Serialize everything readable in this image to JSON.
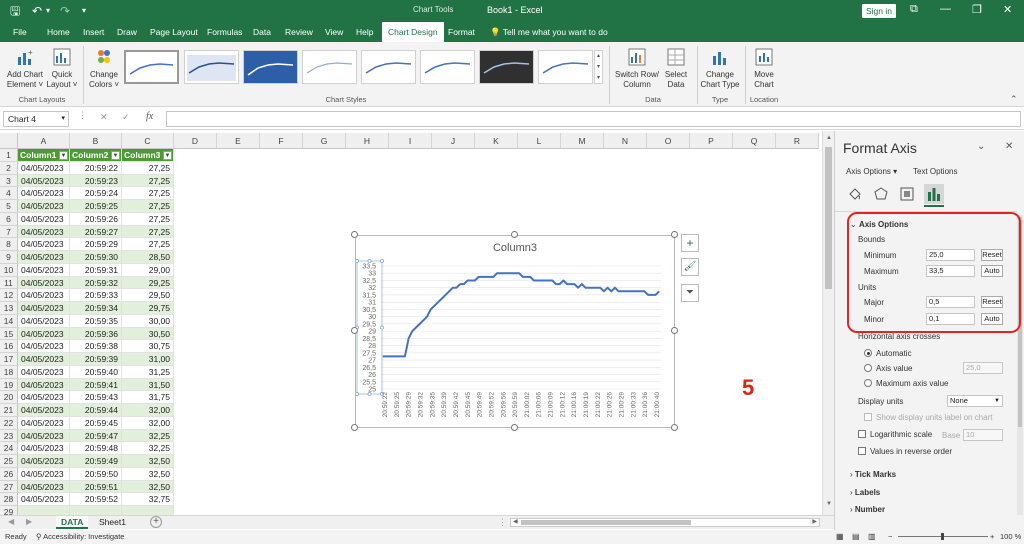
{
  "titlebar": {
    "document": "Book1  -  Excel",
    "context_label": "Chart Tools",
    "sign_in": "Sign in"
  },
  "tabs": [
    "File",
    "Home",
    "Insert",
    "Draw",
    "Page Layout",
    "Formulas",
    "Data",
    "Review",
    "View",
    "Help",
    "Chart Design",
    "Format"
  ],
  "active_tab": "Chart Design",
  "tell_me": "Tell me what you want to do",
  "ribbon": {
    "add_chart_element": "Add Chart\nElement ˅",
    "quick_layout": "Quick\nLayout ˅",
    "change_colors": "Change\nColors ˅",
    "group_chart_layouts": "Chart Layouts",
    "group_chart_styles": "Chart Styles",
    "switch_row_column": "Switch Row/\nColumn",
    "select_data": "Select\nData",
    "group_data": "Data",
    "change_chart_type": "Change\nChart Type",
    "group_type": "Type",
    "move_chart": "Move\nChart",
    "group_location": "Location"
  },
  "formula_bar": {
    "name_box": "Chart 4",
    "fx": "fx"
  },
  "columns": [
    "A",
    "B",
    "C",
    "D",
    "E",
    "F",
    "G",
    "H",
    "I",
    "J",
    "K",
    "L",
    "M",
    "N",
    "O",
    "P",
    "Q",
    "R"
  ],
  "table": {
    "headers": [
      "Column1",
      "Column2",
      "Column3"
    ],
    "rows": [
      [
        "04/05/2023",
        "20:59:22",
        "27,25"
      ],
      [
        "04/05/2023",
        "20:59:23",
        "27,25"
      ],
      [
        "04/05/2023",
        "20:59:24",
        "27,25"
      ],
      [
        "04/05/2023",
        "20:59:25",
        "27,25"
      ],
      [
        "04/05/2023",
        "20:59:26",
        "27,25"
      ],
      [
        "04/05/2023",
        "20:59:27",
        "27,25"
      ],
      [
        "04/05/2023",
        "20:59:29",
        "27,25"
      ],
      [
        "04/05/2023",
        "20:59:30",
        "28,50"
      ],
      [
        "04/05/2023",
        "20:59:31",
        "29,00"
      ],
      [
        "04/05/2023",
        "20:59:32",
        "29,25"
      ],
      [
        "04/05/2023",
        "20:59:33",
        "29,50"
      ],
      [
        "04/05/2023",
        "20:59:34",
        "29,75"
      ],
      [
        "04/05/2023",
        "20:59:35",
        "30,00"
      ],
      [
        "04/05/2023",
        "20:59:36",
        "30,50"
      ],
      [
        "04/05/2023",
        "20:59:38",
        "30,75"
      ],
      [
        "04/05/2023",
        "20:59:39",
        "31,00"
      ],
      [
        "04/05/2023",
        "20:59:40",
        "31,25"
      ],
      [
        "04/05/2023",
        "20:59:41",
        "31,50"
      ],
      [
        "04/05/2023",
        "20:59:43",
        "31,75"
      ],
      [
        "04/05/2023",
        "20:59:44",
        "32,00"
      ],
      [
        "04/05/2023",
        "20:59:45",
        "32,00"
      ],
      [
        "04/05/2023",
        "20:59:47",
        "32,25"
      ],
      [
        "04/05/2023",
        "20:59:48",
        "32,25"
      ],
      [
        "04/05/2023",
        "20:59:49",
        "32,50"
      ],
      [
        "04/05/2023",
        "20:59:50",
        "32,50"
      ],
      [
        "04/05/2023",
        "20:59:51",
        "32,50"
      ],
      [
        "04/05/2023",
        "20:59:52",
        "32,75"
      ]
    ]
  },
  "chart_data": {
    "type": "line",
    "title": "Column3",
    "ylim": [
      25,
      33.5
    ],
    "y_ticks": [
      "33,5",
      "33",
      "32,5",
      "32",
      "31,5",
      "31",
      "30,5",
      "30",
      "29,5",
      "29",
      "28,5",
      "28",
      "27,5",
      "27",
      "26,5",
      "26",
      "25,5",
      "25"
    ],
    "x_ticks": [
      "20:59:22",
      "20:59:25",
      "20:59:29",
      "20:59:32",
      "20:59:35",
      "20:59:39",
      "20:59:42",
      "20:59:45",
      "20:59:49",
      "20:59:52",
      "20:59:56",
      "20:59:59",
      "21:00:02",
      "21:00:06",
      "21:00:09",
      "21:00:12",
      "21:00:16",
      "21:00:19",
      "21:00:22",
      "21:00:26",
      "21:00:29",
      "21:00:33",
      "21:00:36",
      "21:00:40"
    ],
    "values": [
      27.25,
      27.25,
      27.25,
      27.25,
      27.25,
      27.25,
      27.25,
      28.5,
      29,
      29.25,
      29.5,
      29.75,
      30,
      30.5,
      30.75,
      31,
      31.25,
      31.5,
      31.75,
      32,
      32,
      32.25,
      32.25,
      32.5,
      32.5,
      32.5,
      32.75,
      32.75,
      32.75,
      32.75,
      32.75,
      33,
      33,
      33,
      33,
      33,
      33,
      33,
      32.75,
      32.75,
      32.75,
      32.5,
      32.5,
      32.5,
      32.5,
      32.5,
      32.5,
      32.25,
      32.25,
      32.5,
      32.25,
      32.25,
      32.25,
      32,
      32.25,
      32,
      32,
      32,
      32,
      32,
      31.75,
      32,
      31.75,
      32,
      31.75,
      31.75,
      31.75,
      31.75,
      31.75,
      31.75,
      31.75,
      31.75,
      31.5,
      31.5,
      31.5,
      31.75
    ]
  },
  "annotation": "5",
  "sheets": [
    "DATA",
    "Sheet1"
  ],
  "status": {
    "ready": "Ready",
    "accessibility": "Accessibility: Investigate",
    "zoom": "100 %"
  },
  "pane": {
    "title": "Format Axis",
    "axis_options_tab": "Axis Options",
    "text_options_tab": "Text Options",
    "section_axis_options": "Axis Options",
    "bounds": "Bounds",
    "minimum_label": "Minimum",
    "minimum_value": "25,0",
    "maximum_label": "Maximum",
    "maximum_value": "33,5",
    "reset": "Reset",
    "auto": "Auto",
    "units": "Units",
    "major_label": "Major",
    "major_value": "0,5",
    "minor_label": "Minor",
    "minor_value": "0,1",
    "horizontal_axis_crosses": "Horizontal axis crosses",
    "crosses_automatic": "Automatic",
    "crosses_axis_value": "Axis value",
    "crosses_axis_value_input": "25,0",
    "crosses_maximum": "Maximum axis value",
    "display_units": "Display units",
    "display_units_value": "None",
    "show_units_label": "Show display units label on chart",
    "logarithmic": "Logarithmic scale",
    "base_label": "Base",
    "base_value": "10",
    "reverse_order": "Values in reverse order",
    "tick_marks": "Tick Marks",
    "labels": "Labels",
    "number": "Number"
  }
}
